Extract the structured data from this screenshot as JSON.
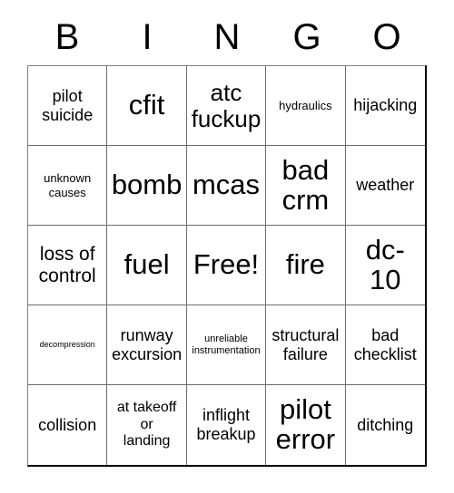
{
  "header": {
    "letters": [
      "B",
      "I",
      "N",
      "G",
      "O"
    ]
  },
  "grid": {
    "columns": 5,
    "rows": 5,
    "border_color": "#6e6e6e",
    "cell_background": "#ffffff",
    "text_color": "#000000",
    "cells": [
      {
        "text": "pilot\nsuicide",
        "size": "ml",
        "free": false
      },
      {
        "text": "cfit",
        "size": "xxl",
        "free": false
      },
      {
        "text": "atc\nfuckup",
        "size": "xl",
        "free": false
      },
      {
        "text": "hydraulics",
        "size": "sm",
        "free": false
      },
      {
        "text": "hijacking",
        "size": "ml",
        "free": false
      },
      {
        "text": "unknown\ncauses",
        "size": "sm",
        "free": false
      },
      {
        "text": "bomb",
        "size": "xxl",
        "free": false
      },
      {
        "text": "mcas",
        "size": "xxl",
        "free": false
      },
      {
        "text": "bad\ncrm",
        "size": "xxl",
        "free": false
      },
      {
        "text": "weather",
        "size": "ml",
        "free": false
      },
      {
        "text": "loss of\ncontrol",
        "size": "l",
        "free": false
      },
      {
        "text": "fuel",
        "size": "xxl",
        "free": false
      },
      {
        "text": "Free!",
        "size": "xxl",
        "free": true
      },
      {
        "text": "fire",
        "size": "xxl",
        "free": false
      },
      {
        "text": "dc-\n10",
        "size": "xxl",
        "free": false
      },
      {
        "text": "decompression",
        "size": "xs",
        "free": false
      },
      {
        "text": "runway\nexcursion",
        "size": "ml",
        "free": false
      },
      {
        "text": "unreliable\ninstrumentation",
        "size": "s",
        "free": false
      },
      {
        "text": "structural\nfailure",
        "size": "ml",
        "free": false
      },
      {
        "text": "bad\nchecklist",
        "size": "ml",
        "free": false
      },
      {
        "text": "collision",
        "size": "ml",
        "free": false
      },
      {
        "text": "at takeoff\nor\nlanding",
        "size": "m",
        "free": false
      },
      {
        "text": "inflight\nbreakup",
        "size": "ml",
        "free": false
      },
      {
        "text": "pilot\nerror",
        "size": "xxl",
        "free": false
      },
      {
        "text": "ditching",
        "size": "ml",
        "free": false
      }
    ]
  }
}
